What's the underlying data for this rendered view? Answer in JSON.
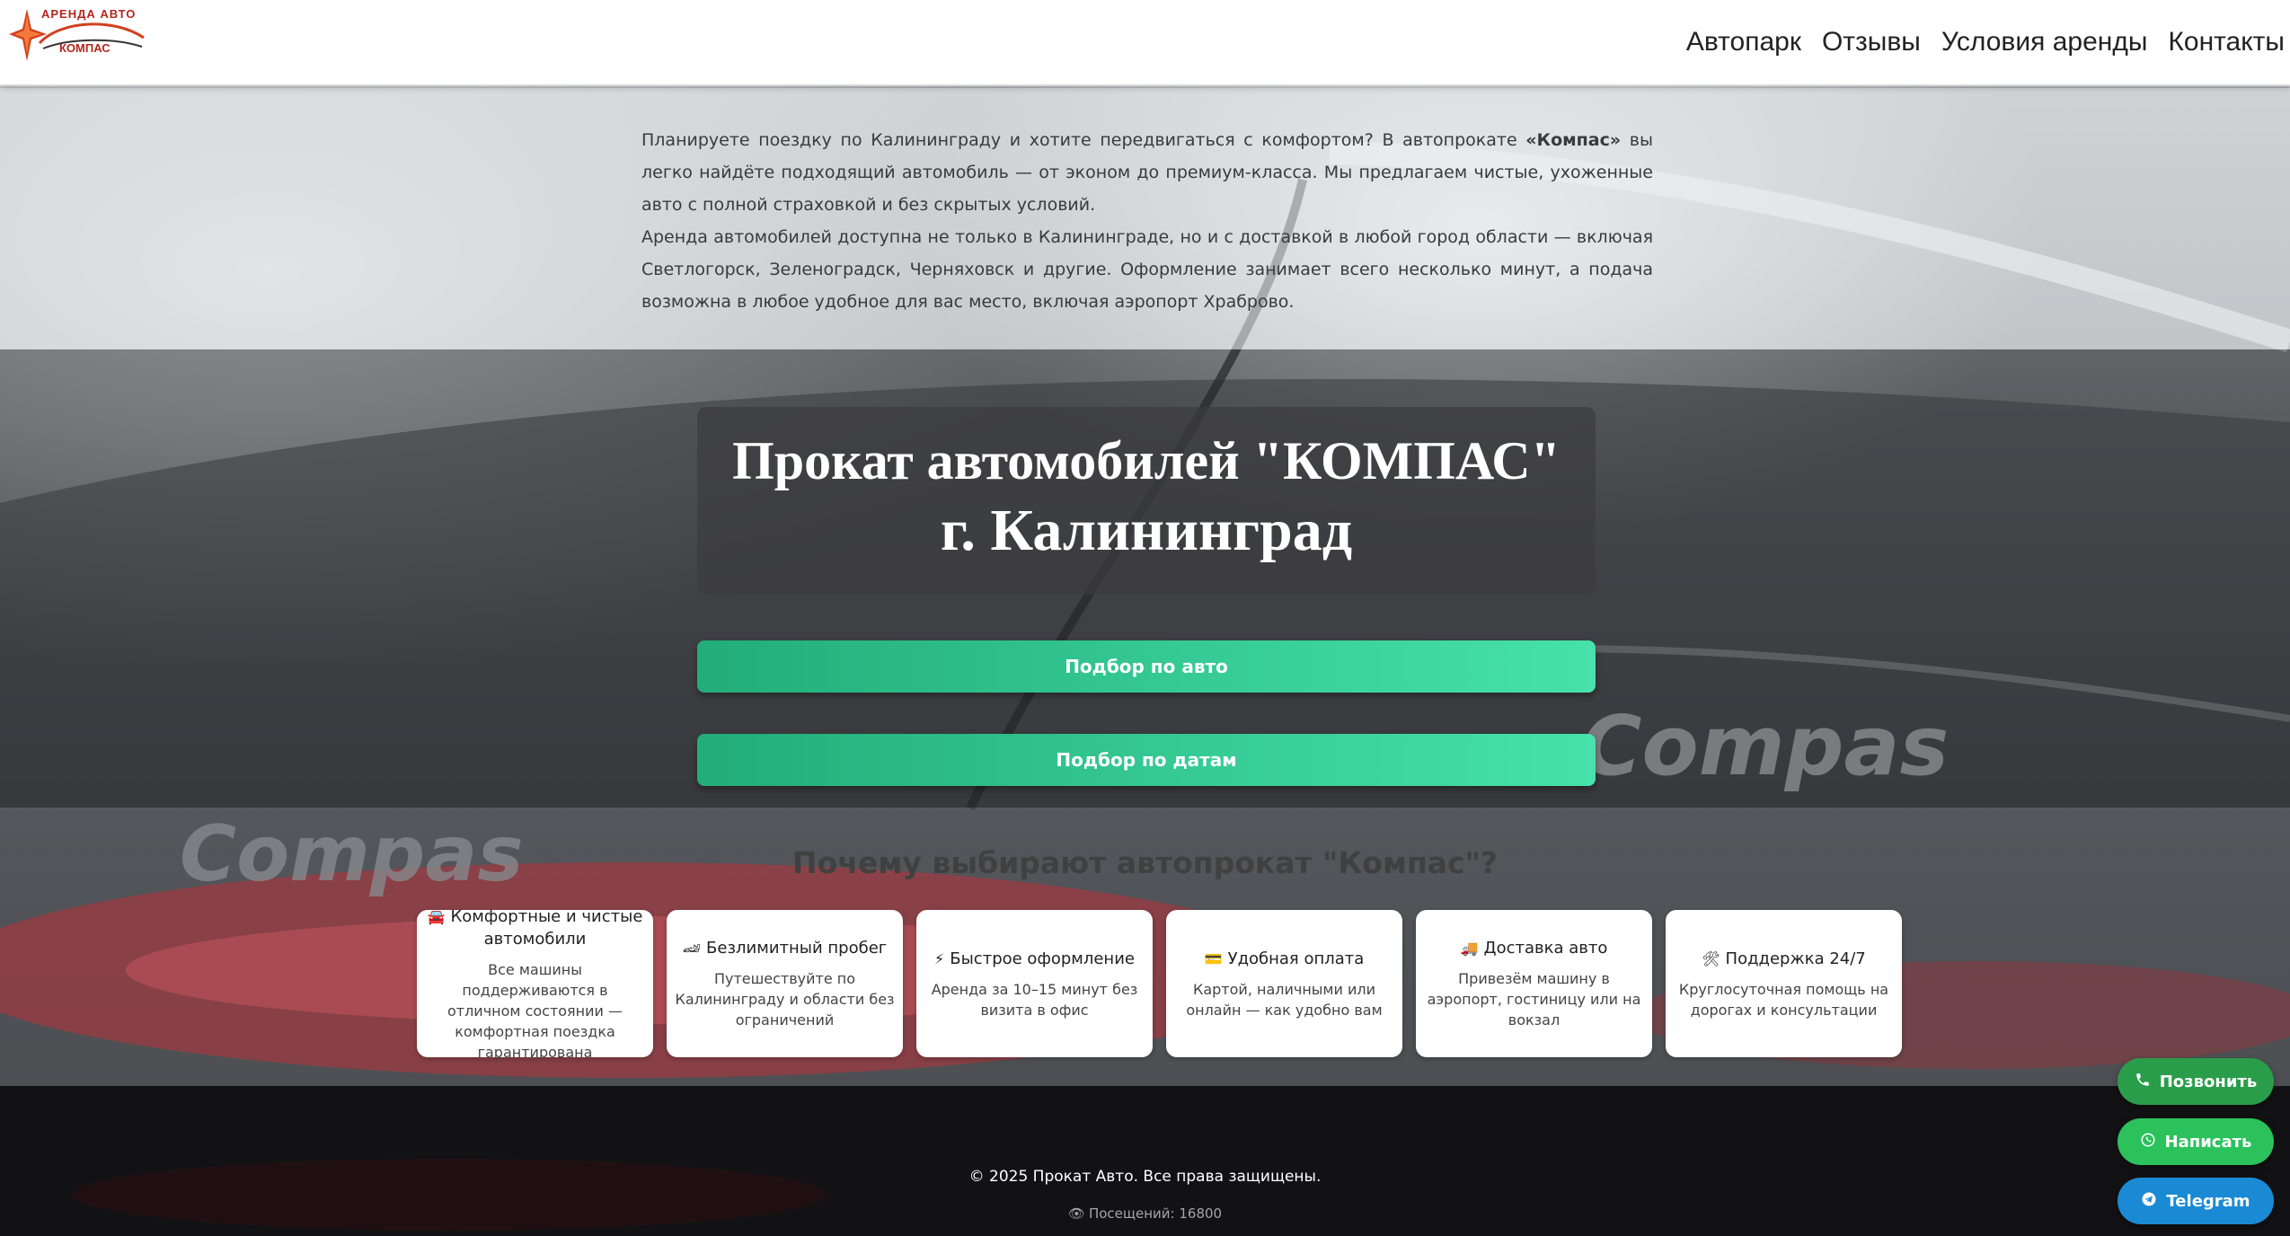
{
  "header": {
    "logo_top": "АРЕНДА  АВТО",
    "logo_bottom": "КОМПАС",
    "nav": [
      {
        "label": "Автопарк"
      },
      {
        "label": "Отзывы"
      },
      {
        "label": "Условия аренды"
      },
      {
        "label": "Контакты"
      }
    ]
  },
  "intro": {
    "p1_before": "Планируете поездку по Калининграду и хотите передвигаться с комфортом? В автопрокате ",
    "p1_bold": "«Компас»",
    "p1_after": " вы легко найдёте подходящий автомобиль — от эконом до премиум-класса. Мы предлагаем чистые, ухоженные авто с полной страховкой и без скрытых условий.",
    "p2": "Аренда автомобилей доступна не только в Калининграде, но и с доставкой в любой город области — включая Светлогорск, Зеленоградск, Черняховск и другие. Оформление занимает всего несколько минут, а подача возможна в любое удобное для вас место, включая аэропорт Храброво."
  },
  "hero": {
    "title_line1": "Прокат автомобилей \"КОМПАС\"",
    "title_line2": "г. Калининград",
    "button_auto": "Подбор по авто",
    "button_dates": "Подбор по датам"
  },
  "why": {
    "title": "Почему выбирают автопрокат \"Компас\"?",
    "cards": [
      {
        "icon": "🚘",
        "icon_name": "car-icon",
        "title": "Комфортные и чистые автомобили",
        "text": "Все машины поддерживаются в отличном состоянии — комфортная поездка гарантирована"
      },
      {
        "icon": "🏎",
        "icon_name": "race-car-icon",
        "title": "Безлимитный пробег",
        "text": "Путешествуйте по Калининграду и области без ограничений"
      },
      {
        "icon": "⚡",
        "icon_name": "lightning-icon",
        "title": "Быстрое оформление",
        "text": "Аренда за 10–15 минут без визита в офис"
      },
      {
        "icon": "💳",
        "icon_name": "credit-card-icon",
        "title": "Удобная оплата",
        "text": "Картой, наличными или онлайн — как удобно вам"
      },
      {
        "icon": "🚚",
        "icon_name": "delivery-truck-icon",
        "title": "Доставка авто",
        "text": "Привезём машину в аэропорт, гостиницу или на вокзал"
      },
      {
        "icon": "🛠",
        "icon_name": "tools-icon",
        "title": "Поддержка 24/7",
        "text": "Круглосуточная помощь на дорогах и консультации"
      }
    ]
  },
  "footer": {
    "copyright": "© 2025 Прокат Авто. Все права защищены.",
    "visits": "Посещений: 16800",
    "eye_icon": "👁"
  },
  "floating": {
    "call": "Позвонить",
    "write": "Написать",
    "telegram": "Telegram"
  },
  "colors": {
    "accent_green_start": "#22ad79",
    "accent_green_end": "#46e2aa",
    "call_green": "#2a9d4a",
    "whatsapp_green": "#2bc25c",
    "telegram_blue": "#1a8ad4"
  }
}
